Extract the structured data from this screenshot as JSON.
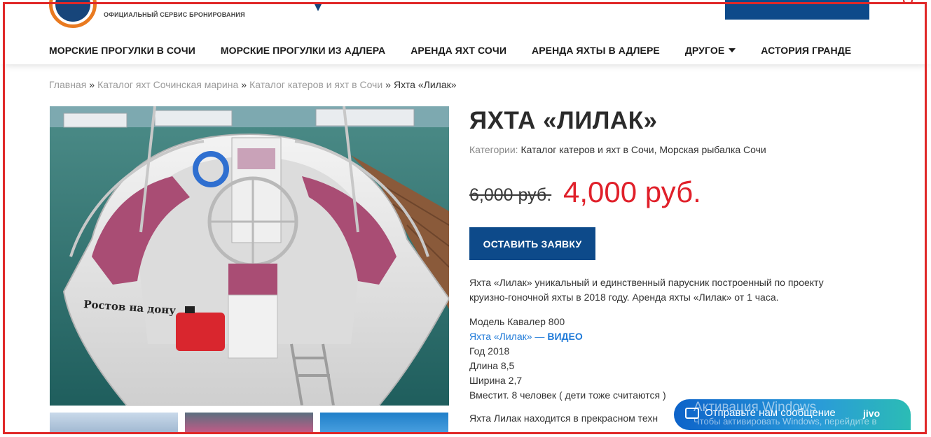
{
  "header": {
    "logo_subtitle": "ОФИЦИАЛЬНЫЙ СЕРВИС БРОНИРОВАНИЯ",
    "nav": [
      {
        "label": "МОРСКИЕ ПРОГУЛКИ В СОЧИ"
      },
      {
        "label": "МОРСКИЕ ПРОГУЛКИ ИЗ АДЛЕРА"
      },
      {
        "label": "АРЕНДА ЯХТ СОЧИ"
      },
      {
        "label": "АРЕНДА ЯХТЫ В АДЛЕРЕ"
      },
      {
        "label": "ДРУГОЕ"
      },
      {
        "label": "АСТОРИЯ ГРАНДЕ"
      }
    ]
  },
  "breadcrumb": {
    "items": [
      {
        "label": "Главная"
      },
      {
        "label": "Каталог яхт Сочинская марина"
      },
      {
        "label": "Каталог катеров и яхт в Сочи"
      }
    ],
    "separator": "»",
    "current": "Яхта «Лилак»"
  },
  "product": {
    "title": "ЯХТА «ЛИЛАК»",
    "categories_label": "Категории:",
    "categories": [
      "Каталог катеров и яхт в Сочи",
      "Морская рыбалка Сочи"
    ],
    "old_price": "6,000 руб.",
    "new_price": "4,000 руб.",
    "cta_label": "ОСТАВИТЬ ЗАЯВКУ",
    "image_caption": "Ростов на дону",
    "description_line1": "Яхта «Лилак» уникальный и единственный парусник построенный по проекту",
    "description_line2": "круизно-гоночной яхты в 2018 году. Аренда яхты «Лилак» от 1 часа.",
    "specs": {
      "model": "Модель Кавалер 800",
      "video_prefix": "Яхта «Лилак» — ",
      "video_bold": "ВИДЕО",
      "year": "Год 2018",
      "length": "Длина 8,5",
      "width": "Ширина 2,7",
      "capacity": "Вместит. 8 человек ( дети тоже считаются )"
    },
    "more_text": "Яхта Лилак находится в прекрасном техн"
  },
  "chat": {
    "label": "Отправьте нам сообщение",
    "brand": "jivo"
  },
  "watermark": {
    "title": "Активация Windows",
    "subtitle": "Чтобы активировать Windows, перейдите в"
  },
  "colors": {
    "brand_blue": "#0d4a8a",
    "price_red": "#e0202a",
    "link_blue": "#1f7ad8",
    "frame_red": "#e02828"
  }
}
